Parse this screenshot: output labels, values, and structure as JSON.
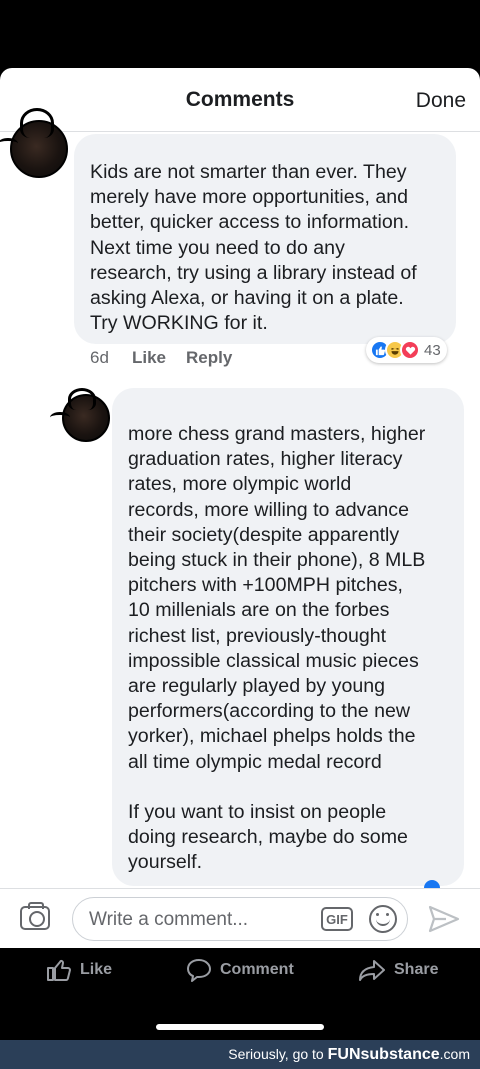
{
  "header": {
    "title": "Comments",
    "done_label": "Done"
  },
  "comments": [
    {
      "text": "Kids are not smarter than ever. They\nmerely have more opportunities, and\nbetter, quicker access to information.\nNext time you need to do any\nresearch, try using a library instead of\nasking Alexa, or having it on a plate.\nTry WORKING for it.",
      "age": "6d",
      "like_label": "Like",
      "reply_label": "Reply",
      "reactions": {
        "icons": [
          "like-reaction-icon",
          "haha-reaction-icon",
          "love-reaction-icon"
        ],
        "count": "43"
      }
    },
    {
      "text": "more chess grand masters, higher\ngraduation rates, higher literacy\nrates, more olympic world\nrecords, more willing to advance\ntheir society(despite apparently\nbeing stuck in their phone), 8 MLB\npitchers with +100MPH pitches,\n10 millenials are on the forbes\nrichest list, previously-thought\nimpossible classical music pieces\nare regularly played by young\nperformers(according to the new\nyorker), michael phelps holds the\nall time olympic medal record\n\nIf you want to insist on people\ndoing research, maybe do some\nyourself."
    }
  ],
  "composer": {
    "placeholder": "Write a comment...",
    "gif_label": "GIF"
  },
  "tabs": [
    {
      "label": "Like",
      "icon": "thumbs-up-icon"
    },
    {
      "label": "Comment",
      "icon": "speech-bubble-icon"
    },
    {
      "label": "Share",
      "icon": "share-arrow-icon"
    }
  ],
  "watermark": {
    "prefix": "Seriously, go to ",
    "brand": "FUNsubstance",
    "suffix": ".com"
  },
  "colors": {
    "accent": "#1877f2",
    "bubble": "#f0f2f5",
    "muted": "#65676b",
    "watermark_bg": "#2b3f58"
  }
}
